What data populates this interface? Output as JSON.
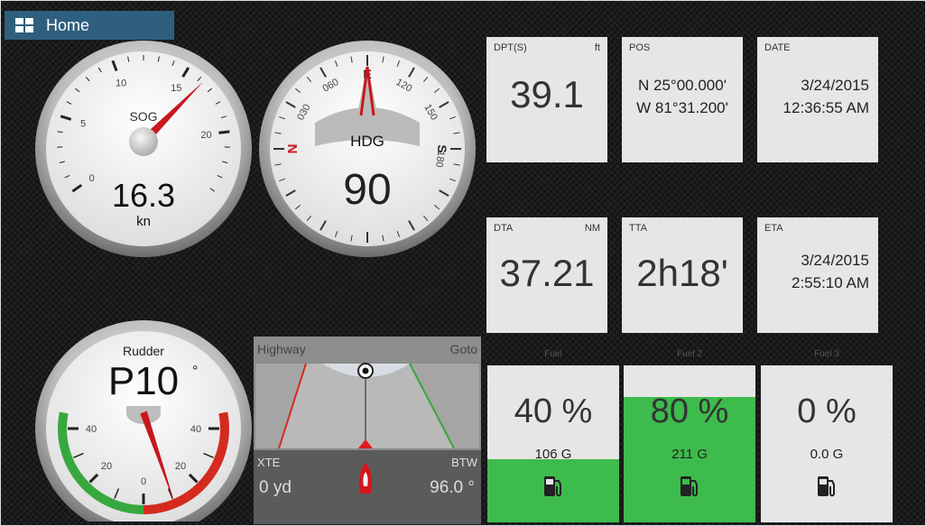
{
  "home": {
    "label": "Home"
  },
  "sog": {
    "title": "SOG",
    "value": "16.3",
    "unit": "kn",
    "scale": [
      "0",
      "5",
      "10",
      "15",
      "20"
    ],
    "needle_value": 16.3
  },
  "hdg": {
    "title": "HDG",
    "value": "90",
    "compass_labels": [
      "N",
      "030",
      "060",
      "E",
      "120",
      "150",
      "S",
      "180"
    ],
    "heading_deg": 90
  },
  "rudder": {
    "title": "Rudder",
    "value": "P10",
    "degree": "°",
    "scale": [
      "40",
      "20",
      "0",
      "20",
      "40"
    ],
    "angle_deg": -10
  },
  "tiles": {
    "dpt": {
      "label": "DPT(S)",
      "unit": "ft",
      "value": "39.1"
    },
    "pos": {
      "label": "POS",
      "lat": "N 25°00.000'",
      "lon": "W 81°31.200'"
    },
    "date": {
      "label": "DATE",
      "date": "3/24/2015",
      "time": "12:36:55 AM"
    },
    "dta": {
      "label": "DTA",
      "unit": "NM",
      "value": "37.21"
    },
    "tta": {
      "label": "TTA",
      "value": "2h18'"
    },
    "eta": {
      "label": "ETA",
      "date": "3/24/2015",
      "time": "2:55:10 AM"
    }
  },
  "highway": {
    "title": "Highway",
    "mode": "Goto",
    "xte_label": "XTE",
    "xte_value": "0 yd",
    "btw_label": "BTW",
    "btw_value": "96.0 °"
  },
  "fuel": [
    {
      "title": "Fuel",
      "percent_text": "40 %",
      "gallons": "106 G",
      "level": 0.4
    },
    {
      "title": "Fuel 2",
      "percent_text": "80 %",
      "gallons": "211 G",
      "level": 0.8
    },
    {
      "title": "Fuel 3",
      "percent_text": "0 %",
      "gallons": "0.0 G",
      "level": 0.0
    }
  ],
  "colors": {
    "fuel_green": "#3dbb4c",
    "needle_red": "#c8171e",
    "port_red": "#d42a20",
    "starboard_green": "#37a83f",
    "home_blue": "#2f5f7f"
  }
}
